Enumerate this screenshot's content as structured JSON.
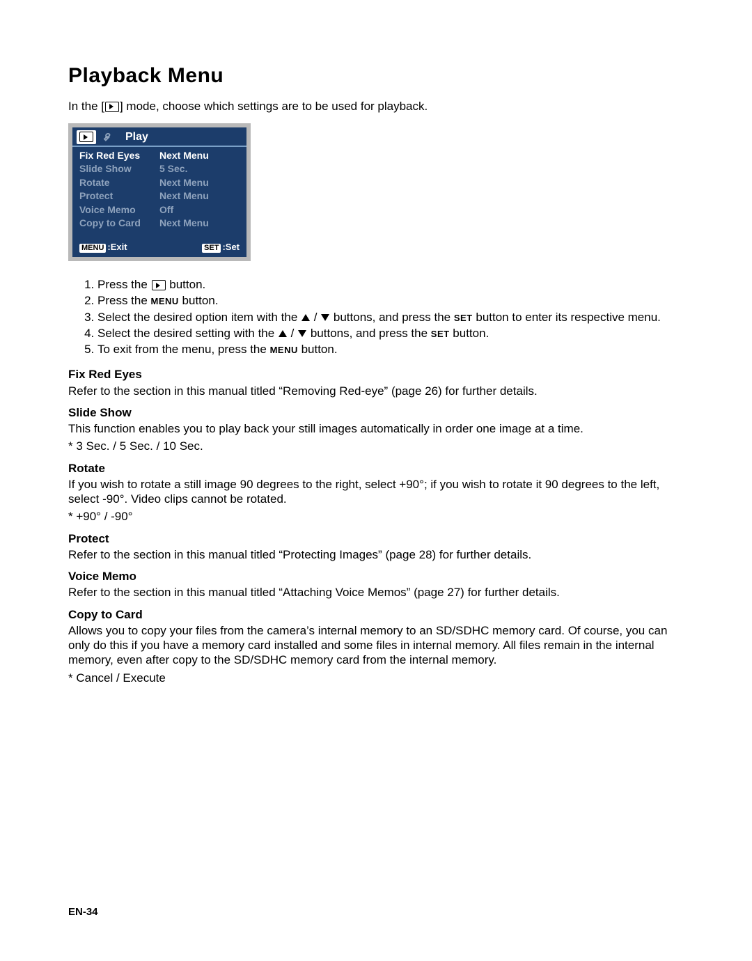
{
  "title": "Playback Menu",
  "intro": {
    "before": "In the [",
    "after": "] mode, choose which settings are to be used for playback."
  },
  "lcd": {
    "top_title": "Play",
    "rows": [
      {
        "label": "Fix Red Eyes",
        "value": "Next Menu",
        "selected": true
      },
      {
        "label": "Slide Show",
        "value": "5 Sec.",
        "selected": false
      },
      {
        "label": "Rotate",
        "value": "Next Menu",
        "selected": false
      },
      {
        "label": "Protect",
        "value": "Next Menu",
        "selected": false
      },
      {
        "label": "Voice Memo",
        "value": "Off",
        "selected": false
      },
      {
        "label": "Copy to Card",
        "value": "Next Menu",
        "selected": false
      }
    ],
    "exit_key": "MENU",
    "exit_label": ":Exit",
    "set_key": "SET",
    "set_label": ":Set"
  },
  "steps": {
    "s1a": "Press the ",
    "s1b": " button.",
    "s2a": "Press the ",
    "s2_key": "MENU",
    "s2b": " button.",
    "s3a": "Select the desired option item with the ",
    "s3b": " / ",
    "s3c": " buttons, and press the ",
    "s3_key": "SET",
    "s3d": " button to enter its respective menu.",
    "s4a": "Select the desired setting with the ",
    "s4b": " / ",
    "s4c": " buttons, and press the ",
    "s4_key": "SET",
    "s4d": " button.",
    "s5a": "To exit from the menu, press the ",
    "s5_key": "MENU",
    "s5b": " button."
  },
  "sections": {
    "fix_red_eyes": {
      "head": "Fix Red Eyes",
      "body": "Refer to the section in this manual titled “Removing Red-eye” (page 26) for further details."
    },
    "slide_show": {
      "head": "Slide Show",
      "body": "This function enables you to play back your still images automatically in order one image at a time.",
      "opts": "*  3 Sec. / 5 Sec. / 10 Sec."
    },
    "rotate": {
      "head": "Rotate",
      "body": "If you wish to rotate a still image 90 degrees to the right, select +90°; if you wish to rotate it 90 degrees to the left, select -90°. Video clips cannot be rotated.",
      "opts": "* +90° / -90°"
    },
    "protect": {
      "head": "Protect",
      "body": "Refer to the section in this manual titled “Protecting Images” (page 28) for further details."
    },
    "voice_memo": {
      "head": "Voice Memo",
      "body": "Refer to the section in this manual titled “Attaching Voice Memos” (page 27) for further details."
    },
    "copy_to_card": {
      "head": "Copy to Card",
      "body": "Allows you to copy your files from the camera’s internal memory to an SD/SDHC memory card. Of course, you can only do this if you have a memory card installed and some files in internal memory. All files remain in the internal memory, even after copy to the SD/SDHC memory card from the internal memory.",
      "opts": "* Cancel / Execute"
    }
  },
  "footer": "EN-34"
}
